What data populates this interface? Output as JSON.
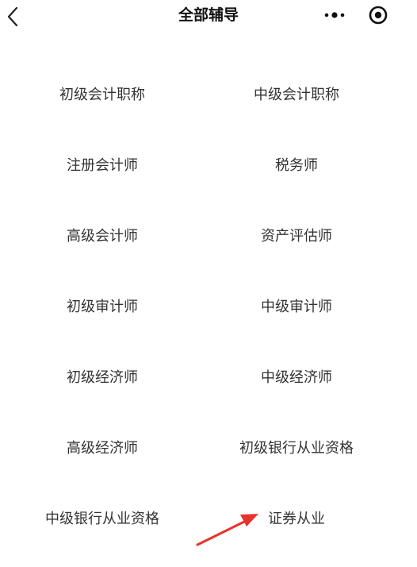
{
  "header": {
    "title": "全部辅导",
    "back_icon": "chevron-left-icon",
    "more_icon": "more-dots-icon",
    "target_icon": "target-icon"
  },
  "items": [
    "初级会计职称",
    "中级会计职称",
    "注册会计师",
    "税务师",
    "高级会计师",
    "资产评估师",
    "初级审计师",
    "中级审计师",
    "初级经济师",
    "中级经济师",
    "高级经济师",
    "初级银行从业资格",
    "中级银行从业资格",
    "证券从业"
  ],
  "colors": {
    "text": "#333333",
    "title": "#111111",
    "annotation_arrow": "#e8332a"
  }
}
